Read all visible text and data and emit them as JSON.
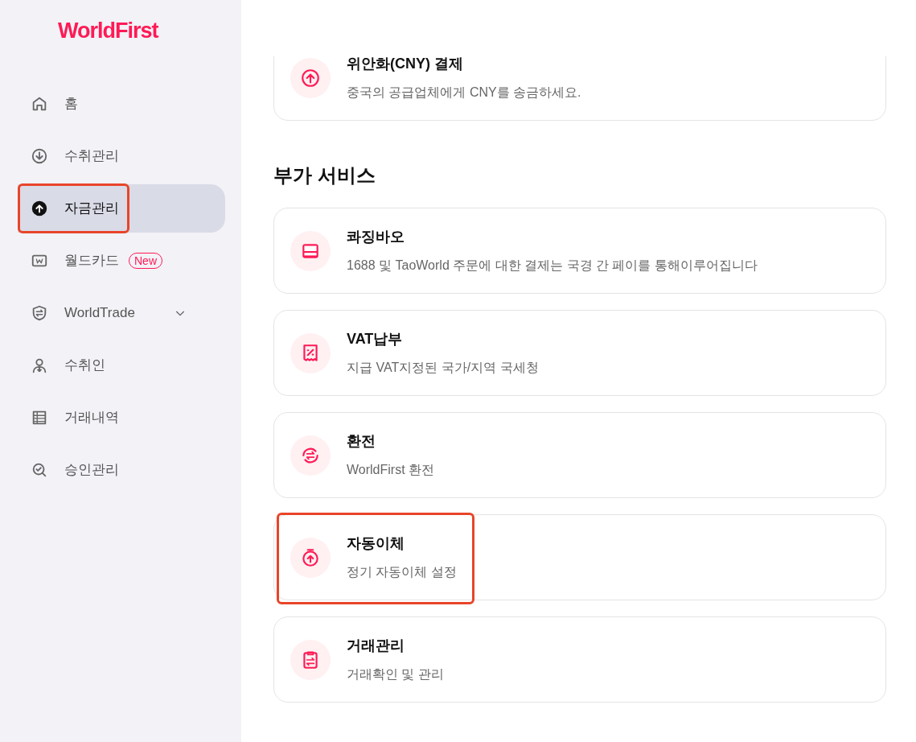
{
  "logo": {
    "text": "WorldFirst"
  },
  "sidebar": {
    "items": [
      {
        "label": "홈",
        "selected": false,
        "highlighted": false
      },
      {
        "label": "수취관리",
        "selected": false,
        "highlighted": false
      },
      {
        "label": "자금관리",
        "selected": true,
        "highlighted": true
      },
      {
        "label": "월드카드",
        "selected": false,
        "highlighted": false,
        "badge": "New"
      },
      {
        "label": "WorldTrade",
        "selected": false,
        "highlighted": false,
        "expanded": false
      },
      {
        "label": "수취인",
        "selected": false,
        "highlighted": false
      },
      {
        "label": "거래내역",
        "selected": false,
        "highlighted": false
      },
      {
        "label": "승인관리",
        "selected": false,
        "highlighted": false
      }
    ]
  },
  "top_card": {
    "title": "위안화(CNY) 결제",
    "description": "중국의 공급업체에게 CNY를 송금하세요.",
    "highlighted": false
  },
  "section": {
    "title": "부가 서비스",
    "cards": [
      {
        "title": "콰징바오",
        "description": "1688 및 TaoWorld 주문에 대한 결제는 국경 간 페이를 통해이루어집니다",
        "highlighted": false
      },
      {
        "title": "VAT납부",
        "description": "지급 VAT지정된 국가/지역 국세청",
        "highlighted": false
      },
      {
        "title": "환전",
        "description": "WorldFirst 환전",
        "highlighted": false
      },
      {
        "title": "자동이체",
        "description": "정기 자동이체 설정",
        "highlighted": true
      },
      {
        "title": "거래관리",
        "description": "거래확인 및 관리",
        "highlighted": false
      }
    ]
  }
}
